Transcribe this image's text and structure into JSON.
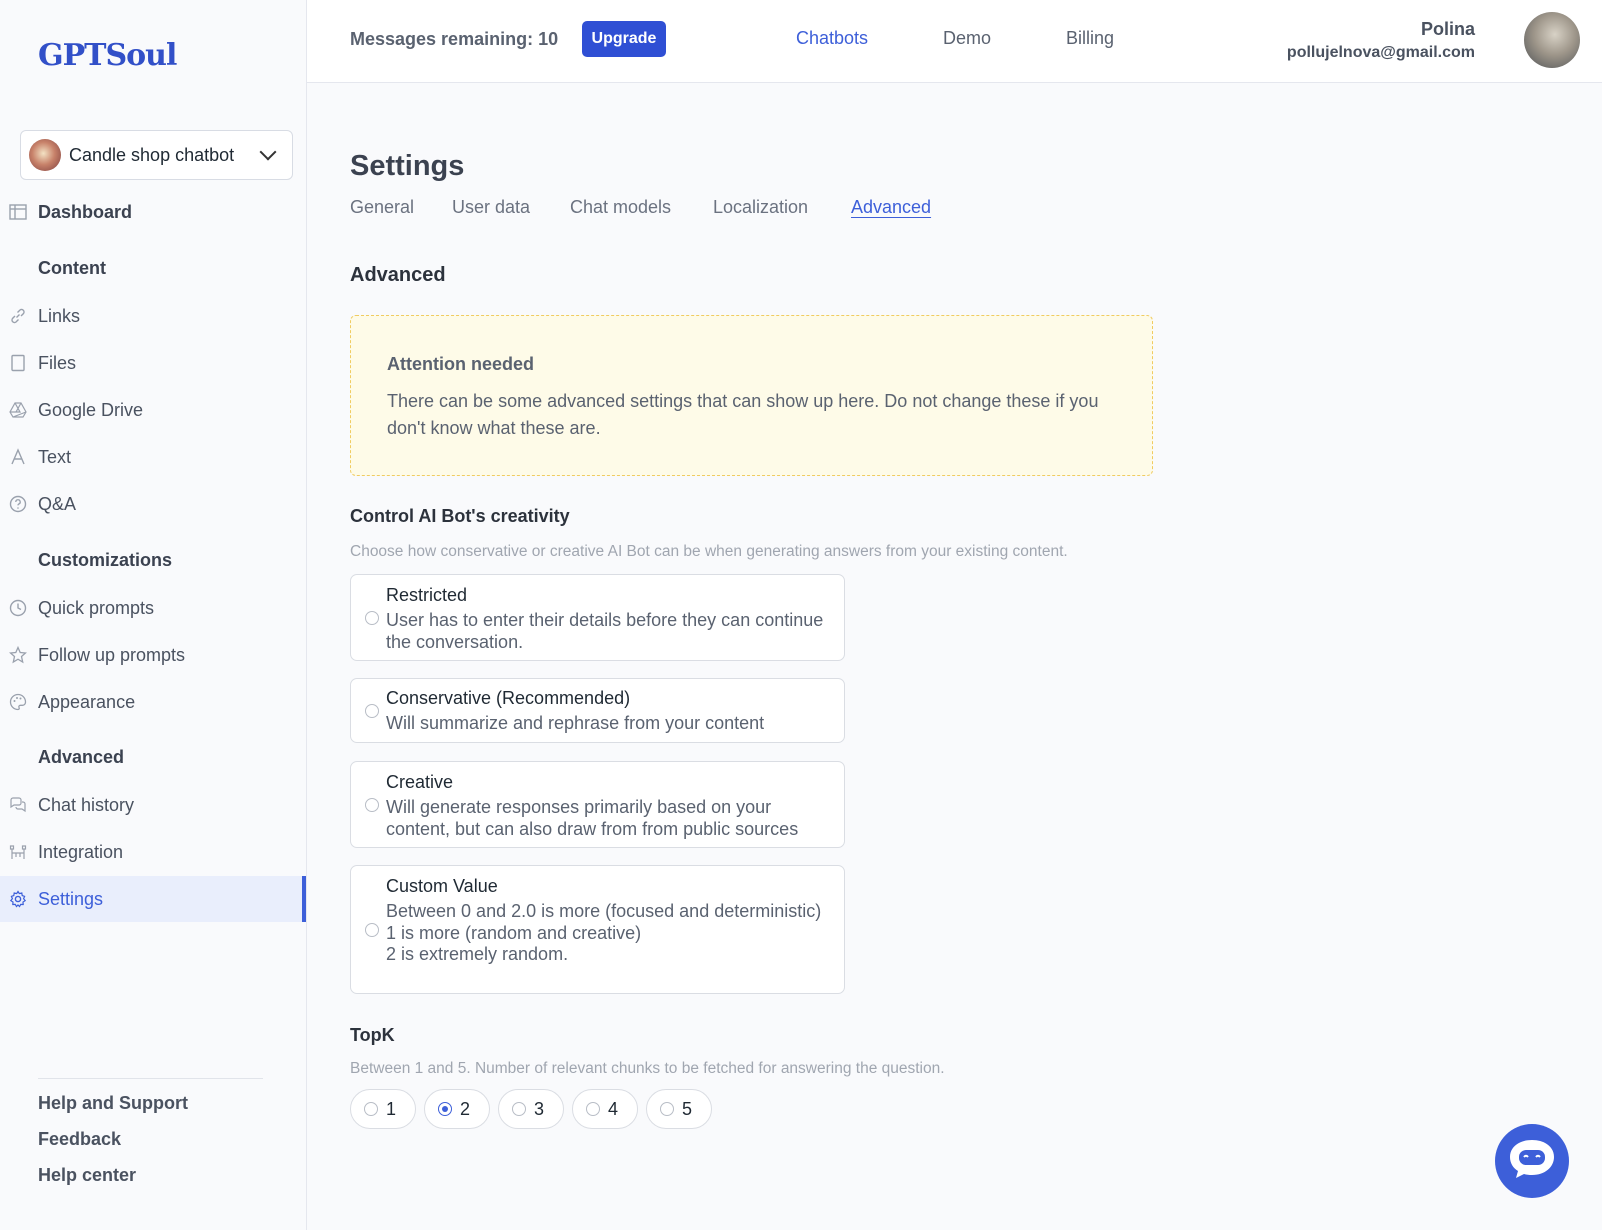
{
  "brand": {
    "logo": "GPTSoul"
  },
  "bot_selector": {
    "name": "Candle shop chatbot"
  },
  "sidebar": {
    "dashboard": "Dashboard",
    "content_header": "Content",
    "content_items": [
      "Links",
      "Files",
      "Google Drive",
      "Text",
      "Q&A"
    ],
    "customizations_header": "Customizations",
    "customization_items": [
      "Quick prompts",
      "Follow up prompts",
      "Appearance"
    ],
    "advanced_header": "Advanced",
    "advanced_items": [
      "Chat history",
      "Integration",
      "Settings"
    ],
    "footer_links": [
      "Help and Support",
      "Feedback",
      "Help center"
    ]
  },
  "topbar": {
    "messages_remaining": "Messages remaining: 10",
    "upgrade": "Upgrade",
    "nav": [
      "Chatbots",
      "Demo",
      "Billing"
    ],
    "user_name": "Polina",
    "user_email": "pollujelnova@gmail.com"
  },
  "page": {
    "title": "Settings",
    "tabs": [
      "General",
      "User data",
      "Chat models",
      "Localization",
      "Advanced"
    ],
    "active_tab": "Advanced",
    "section_title": "Advanced"
  },
  "alert": {
    "title": "Attention needed",
    "body": "There can be some advanced settings that can show up here. Do not change these if you don't know what these are."
  },
  "creativity": {
    "title": "Control AI Bot's creativity",
    "description": "Choose how conservative or creative AI Bot can be when generating answers from your existing content.",
    "options": [
      {
        "title": "Restricted",
        "desc": "User has to enter their details before they can continue the conversation.",
        "selected": false
      },
      {
        "title": "Conservative (Recommended)",
        "desc": "Will summarize and rephrase from your content",
        "selected": false
      },
      {
        "title": "Creative",
        "desc": "Will generate responses primarily based on your content, but can also draw from from public sources",
        "selected": false
      },
      {
        "title": "Custom Value",
        "desc_lines": [
          "Between 0 and 2.0 is more (focused and deterministic)",
          "1 is more (random and creative)",
          "2 is extremely random."
        ],
        "selected": false
      }
    ]
  },
  "topk": {
    "title": "TopK",
    "description": "Between 1 and 5. Number of relevant chunks to be fetched for answering the question.",
    "options": [
      "1",
      "2",
      "3",
      "4",
      "5"
    ],
    "selected": "2"
  },
  "colors": {
    "accent": "#3d5fd9",
    "upgrade_bg": "#2f4fd4",
    "alert_bg": "#fefbe8",
    "alert_border": "#f0cc62"
  }
}
